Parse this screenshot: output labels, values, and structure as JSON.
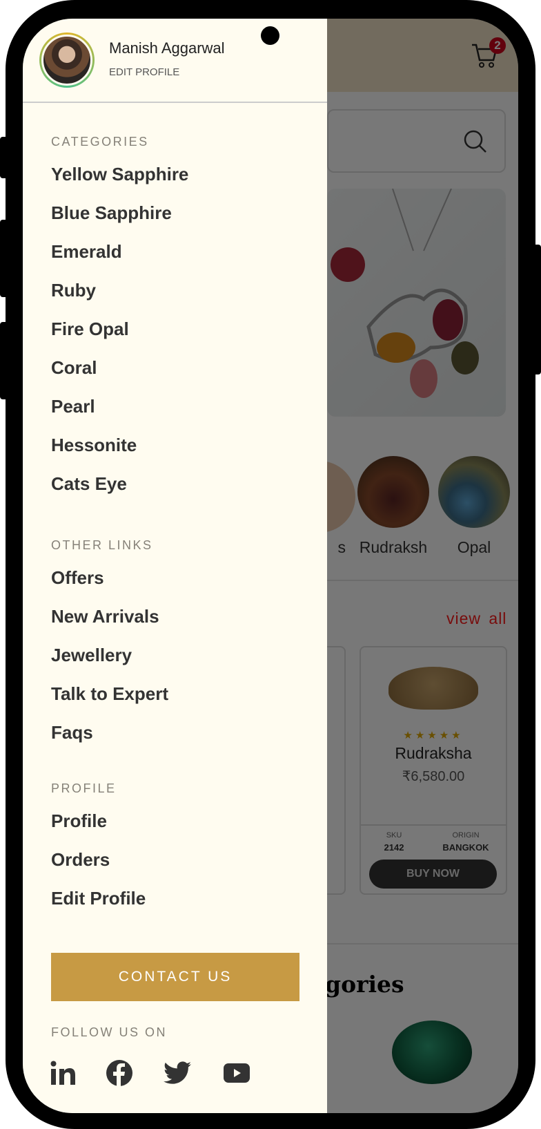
{
  "user": {
    "name": "Manish Aggarwal",
    "edit_profile": "EDIT PROFILE"
  },
  "drawer": {
    "categories_title": "CATEGORIES",
    "categories": [
      "Yellow Sapphire",
      "Blue Sapphire",
      "Emerald",
      "Ruby",
      "Fire Opal",
      "Coral",
      "Pearl",
      "Hessonite",
      "Cats Eye"
    ],
    "other_title": "OTHER LINKS",
    "other": [
      "Offers",
      "New Arrivals",
      "Jewellery",
      "Talk to Expert",
      "Faqs"
    ],
    "profile_title": "PROFILE",
    "profile": [
      "Profile",
      "Orders",
      "Edit Profile"
    ],
    "contact_label": "CONTACT US",
    "follow_title": "FOLLOW US ON",
    "social": [
      "linkedin-icon",
      "facebook-icon",
      "twitter-icon",
      "youtube-icon"
    ]
  },
  "background": {
    "cart_count": "2",
    "circle_labels": [
      "s",
      "Rudraksh",
      "Opal"
    ],
    "view_all": "view all",
    "product": {
      "name": "Rudraksha",
      "price": "₹6,580.00",
      "rating": 5,
      "sku_label": "SKU",
      "sku": "2142",
      "origin_label": "ORIGIN",
      "origin": "BANGKOK",
      "buy": "BUY NOW"
    },
    "section_title_partial": "gories"
  },
  "colors": {
    "accent": "#c79a44",
    "drawer_bg": "#fffcf0",
    "link_red": "#cc0000",
    "badge": "#d0021b"
  }
}
